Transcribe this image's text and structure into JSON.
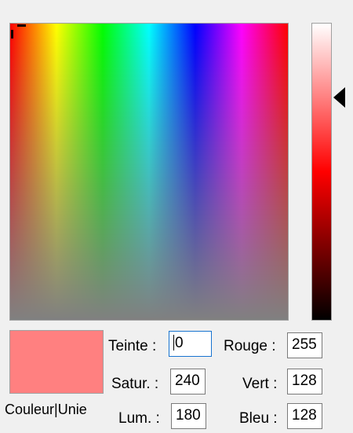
{
  "selected_color": "#ff8080",
  "swatch_label": "Couleur|Unie",
  "fields": {
    "hue": {
      "label": "Teinte :",
      "value": "0"
    },
    "sat": {
      "label": "Satur. :",
      "value": "240"
    },
    "lum": {
      "label": "Lum. :",
      "value": "180"
    },
    "red": {
      "label": "Rouge :",
      "value": "255"
    },
    "green": {
      "label": "Vert :",
      "value": "128"
    },
    "blue": {
      "label": "Bleu :",
      "value": "128"
    }
  },
  "icons": [
    "crosshair-icon",
    "luminance-arrow-icon"
  ],
  "luminance_level": 0.25
}
